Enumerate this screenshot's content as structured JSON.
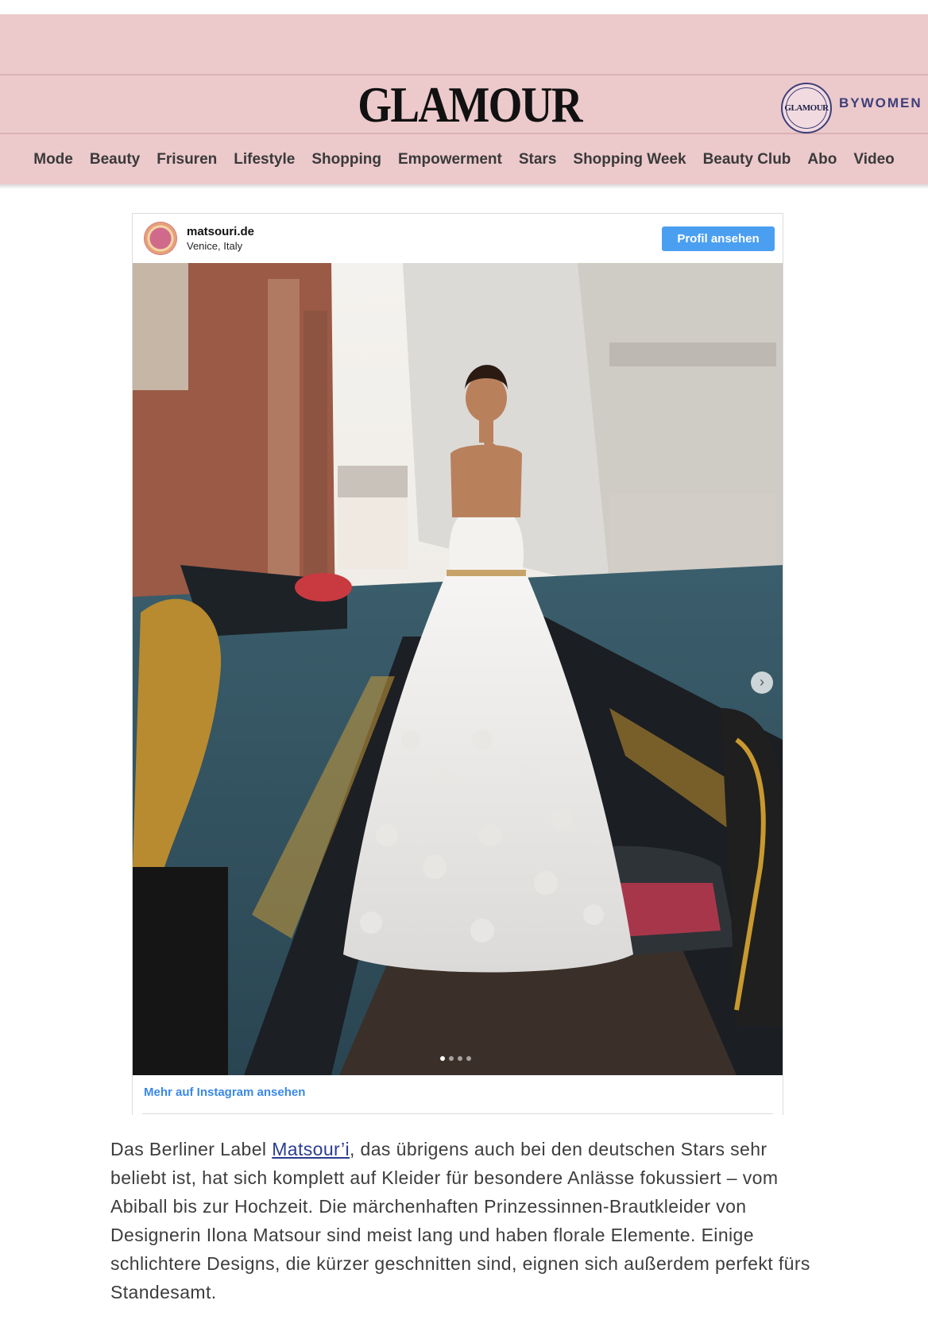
{
  "header": {
    "logo": "GLAMOUR",
    "badge_text": "GLAMOUR",
    "bywomen": "BYWOMEN"
  },
  "nav": {
    "items": [
      "Mode",
      "Beauty",
      "Frisuren",
      "Lifestyle",
      "Shopping",
      "Empowerment",
      "Stars",
      "Shopping Week",
      "Beauty Club",
      "Abo",
      "Video"
    ]
  },
  "instagram": {
    "username": "matsouri.de",
    "location": "Venice, Italy",
    "profile_button": "Profil ansehen",
    "next_arrow": "›",
    "carousel_count": 4,
    "carousel_active": 1,
    "more_link": "Mehr auf Instagram ansehen"
  },
  "article": {
    "before_link": "Das Berliner Label ",
    "link_text": "Matsour’i",
    "after_link": ", das übrigens auch bei den deutschen Stars sehr beliebt ist, hat sich komplett auf Kleider für besondere Anlässe fokussiert – vom Abiball bis zur Hochzeit. Die märchenhaften Prinzessinnen-Brautkleider von Designerin Ilona Matsour sind meist lang und haben florale Elemente. Einige schlichtere Designs, die kürzer geschnitten sind, eignen sich außerdem perfekt fürs Standesamt."
  },
  "colors": {
    "header_bg": "#ecc9cb",
    "profile_button": "#4b9ff0",
    "link_blue": "#3a88e8",
    "article_link": "#2b3d8f",
    "bywomen": "#3d3f7a"
  }
}
